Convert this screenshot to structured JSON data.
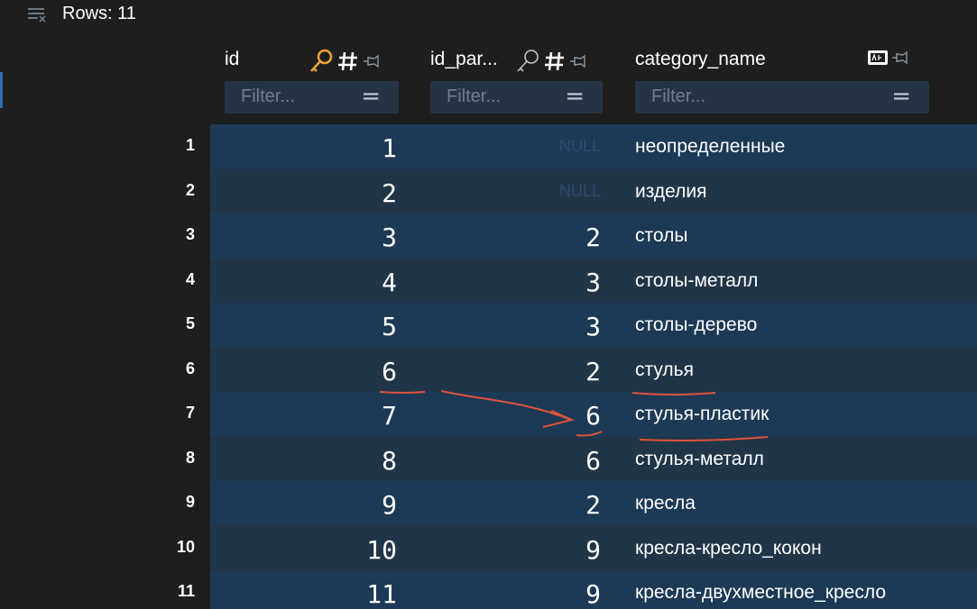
{
  "toolbar": {
    "rows_label": "Rows: 11",
    "rows_icon": "rows-icon"
  },
  "columns": [
    {
      "label": "id",
      "icons": [
        "primary-key-icon",
        "numeric-type-icon",
        "pin-icon"
      ],
      "filter_placeholder": "Filter..."
    },
    {
      "label": "id_par...",
      "icons": [
        "foreign-key-icon",
        "numeric-type-icon",
        "pin-icon"
      ],
      "filter_placeholder": "Filter..."
    },
    {
      "label": "category_name",
      "icons": [
        "text-type-icon",
        "pin-icon"
      ],
      "filter_placeholder": "Filter..."
    }
  ],
  "filter_symbol": "=",
  "rows": [
    {
      "num": "1",
      "id": "1",
      "id_parent": "NULL",
      "category_name": "неопределенные"
    },
    {
      "num": "2",
      "id": "2",
      "id_parent": "NULL",
      "category_name": "изделия"
    },
    {
      "num": "3",
      "id": "3",
      "id_parent": "2",
      "category_name": "столы"
    },
    {
      "num": "4",
      "id": "4",
      "id_parent": "3",
      "category_name": "столы-металл"
    },
    {
      "num": "5",
      "id": "5",
      "id_parent": "3",
      "category_name": "столы-дерево"
    },
    {
      "num": "6",
      "id": "6",
      "id_parent": "2",
      "category_name": "стулья"
    },
    {
      "num": "7",
      "id": "7",
      "id_parent": "6",
      "category_name": "стулья-пластик"
    },
    {
      "num": "8",
      "id": "8",
      "id_parent": "6",
      "category_name": "стулья-металл"
    },
    {
      "num": "9",
      "id": "9",
      "id_parent": "2",
      "category_name": "кресла"
    },
    {
      "num": "10",
      "id": "10",
      "id_parent": "9",
      "category_name": "кресла-кресло_кокон"
    },
    {
      "num": "11",
      "id": "11",
      "id_parent": "9",
      "category_name": "кресла-двухместное_кресло"
    }
  ],
  "colors": {
    "background": "#1e1e1e",
    "row_even": "#1c3a55",
    "row_odd": "#213548",
    "filter_bg": "#243445",
    "key_primary": "#e8a23a",
    "annotation": "#e0533a"
  }
}
